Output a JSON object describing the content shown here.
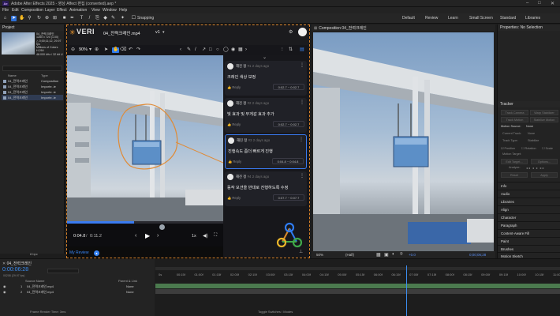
{
  "titlebar": {
    "app_title": "Adobe After Effects 2025 - 영상 Affect 편집 (converted).aep *",
    "logo_text": "Ae"
  },
  "menu": [
    "File",
    "Edit",
    "Composition",
    "Layer",
    "Effect",
    "Animation",
    "View",
    "Window",
    "Help"
  ],
  "toolbar": {
    "snapping_label": "Snapping",
    "workspaces": [
      "Default",
      "Review",
      "Learn",
      "Small Screen",
      "Standard",
      "Libraries"
    ]
  },
  "project": {
    "panel_title": "Project",
    "thumb_info": [
      "04_전력크레인",
      "1280 x 720 (1.00)",
      "△ 0;00;11;12, 29.97 fps",
      "Millions of Colors",
      "H.264",
      "48.000 kHz / 32 bit U"
    ],
    "columns": [
      "Name",
      "Type"
    ],
    "items": [
      {
        "name": "04_전력크레인",
        "type": "Composition"
      },
      {
        "name": "04_전력크레인",
        "type": "Importe..ie"
      },
      {
        "name": "04_전력크레인",
        "type": "Importe..ie"
      },
      {
        "name": "04_전력크레인",
        "type": "Importe..ie"
      }
    ],
    "bpc": "8 bpc"
  },
  "veri": {
    "logo": "VERI",
    "file_name": "04_전력크레인.mp4",
    "version": "v1",
    "zoom": "90%",
    "time_current": "0:04.8",
    "time_total": "0:11.2",
    "speed": "1x",
    "my_review_label": "My Review",
    "comments": [
      {
        "author": "해진 정",
        "num": "#1",
        "ago": "2 days ago",
        "text": "크레인 색상 보정",
        "reply": "Reply",
        "range": "0:02.7 ~ 0:02.7"
      },
      {
        "author": "해진 정",
        "num": "#2",
        "ago": "2 days ago",
        "text": "빛 효과 및 무게감 효과 추가",
        "reply": "Reply",
        "range": "0:02.7 ~ 0:02.7"
      },
      {
        "author": "해진 정",
        "num": "#3",
        "ago": "2 days ago",
        "text": "진행속도 좀더 빠르게 진행",
        "reply": "Reply",
        "range": "0:04.8 ~ 0:04.8"
      },
      {
        "author": "해진 정",
        "num": "#4",
        "ago": "2 days ago",
        "text": "동작 모션을 반대로 진행하도록 수정",
        "reply": "Reply",
        "range": "0:07.7 ~ 0:07.7"
      }
    ]
  },
  "composition": {
    "tab_label": "Composition 04_전력크레인",
    "zoom": "50%",
    "resolution": "(Half)",
    "timecode": "0;00;06;28",
    "exposure": "+0.0"
  },
  "right_panel": {
    "properties_title": "Properties: No Selection",
    "tracker_title": "Tracker",
    "buttons": [
      "Track Camera",
      "Warp Stabilizer",
      "Track Motion",
      "Stabilize Motion"
    ],
    "motion_source_label": "Motion Source:",
    "motion_source_value": "None",
    "current_track_label": "Current Track:",
    "current_track_value": "None",
    "track_type_label": "Track Type:",
    "track_type_value": "Stabilize",
    "checks": [
      "Position",
      "Rotation",
      "Scale"
    ],
    "motion_target_label": "Motion Target:",
    "edit_target": "Edit Target...",
    "options": "Options...",
    "analyze": "Analyze:",
    "reset": "Reset",
    "apply": "Apply",
    "sections": [
      "Info",
      "Audio",
      "Libraries",
      "Align",
      "Character",
      "Paragraph",
      "Content-Aware Fill",
      "Paint",
      "Brushes",
      "Motion Sketch"
    ]
  },
  "timeline": {
    "comp_tab": "04_전력크레인",
    "timecode": "0:00:06:28",
    "fps_note": "00208 (29.97 fps)",
    "col_source": "Source Name",
    "col_parent": "Parent & Link",
    "layers": [
      {
        "num": "1",
        "name": "04_전력크레인.mp4",
        "parent": "None"
      },
      {
        "num": "2",
        "name": "04_전력크레인.mp4",
        "parent": "None"
      }
    ],
    "ruler": [
      "0s",
      "00:15f",
      "01:00f",
      "01:15f",
      "02:00f",
      "02:15f",
      "03:00f",
      "03:15f",
      "04:00f",
      "04:15f",
      "05:00f",
      "05:15f",
      "06:00f",
      "06:15f",
      "07:00f",
      "07:15f",
      "08:00f",
      "08:15f",
      "09:00f",
      "09:15f",
      "10:00f",
      "10:15f",
      "11:00f"
    ],
    "playhead_fraction": 0.62,
    "footer_left": "Frame Render Time: 3ms",
    "footer_mid": "Toggle Switches / Modes"
  }
}
